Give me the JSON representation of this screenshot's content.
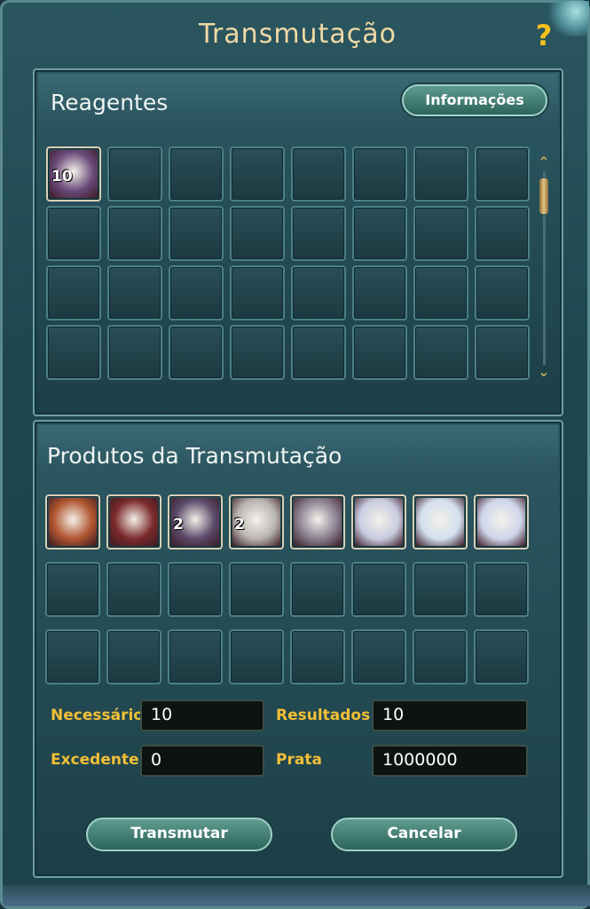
{
  "window": {
    "title": "Transmutação",
    "help_label": "?"
  },
  "reagents": {
    "title": "Reagentes",
    "info_button": "Informações",
    "slots": [
      {
        "filled": true,
        "count": "10",
        "icon": "reagent-orb-icon",
        "color": "#6a4a7a"
      },
      {},
      {},
      {},
      {},
      {},
      {},
      {},
      {},
      {},
      {},
      {},
      {},
      {},
      {},
      {},
      {},
      {},
      {},
      {},
      {},
      {},
      {},
      {},
      {},
      {},
      {},
      {},
      {},
      {},
      {},
      {}
    ],
    "scroll": {
      "up": "⌃",
      "down": "⌄"
    }
  },
  "products": {
    "title": "Produtos da Transmutação",
    "slots": [
      {
        "filled": true,
        "count": "",
        "icon": "helmet-icon",
        "color": "#b0552f"
      },
      {
        "filled": true,
        "count": "",
        "icon": "chest-armor-icon",
        "color": "#7a2a2a"
      },
      {
        "filled": true,
        "count": "2",
        "icon": "leg-armor-icon",
        "color": "#5b4a6a"
      },
      {
        "filled": true,
        "count": "2",
        "icon": "gauntlet-icon",
        "color": "#b9b4b0"
      },
      {
        "filled": true,
        "count": "",
        "icon": "plate-armor-icon",
        "color": "#8a7f90"
      },
      {
        "filled": true,
        "count": "",
        "icon": "robe-icon",
        "color": "#c9cbe0"
      },
      {
        "filled": true,
        "count": "",
        "icon": "white-robe-icon",
        "color": "#d3dff0"
      },
      {
        "filled": true,
        "count": "",
        "icon": "dress-icon",
        "color": "#cfd6ea"
      },
      {},
      {},
      {},
      {},
      {},
      {},
      {},
      {},
      {},
      {},
      {},
      {},
      {},
      {},
      {},
      {}
    ]
  },
  "fields": {
    "necessario": {
      "label": "Necessário",
      "value": "10"
    },
    "resultados": {
      "label": "Resultados",
      "value": "10"
    },
    "excedente": {
      "label": "Excedente",
      "value": "0"
    },
    "prata": {
      "label": "Prata",
      "value": "1000000"
    }
  },
  "buttons": {
    "transmutar": "Transmutar",
    "cancelar": "Cancelar"
  }
}
